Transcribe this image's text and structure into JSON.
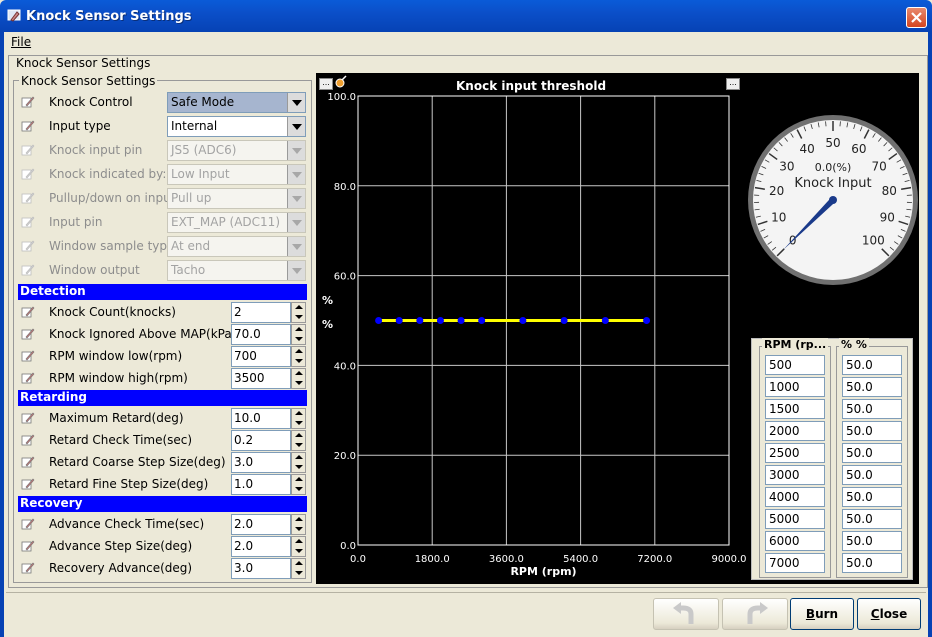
{
  "window": {
    "title": "Knock Sensor Settings"
  },
  "menu": {
    "file": "File"
  },
  "outer_group": {
    "legend": "Knock Sensor Settings"
  },
  "inner_group": {
    "legend": "Knock Sensor Settings"
  },
  "settings": [
    {
      "label": "Knock Control",
      "value": "Safe Mode",
      "type": "combo",
      "enabled": true,
      "highlight": true
    },
    {
      "label": "Input type",
      "value": "Internal",
      "type": "combo",
      "enabled": true
    },
    {
      "label": "Knock input pin",
      "value": "JS5 (ADC6)",
      "type": "combo",
      "enabled": false
    },
    {
      "label": "Knock indicated by:",
      "value": "Low Input",
      "type": "combo",
      "enabled": false
    },
    {
      "label": "Pullup/down on input",
      "value": "Pull up",
      "type": "combo",
      "enabled": false
    },
    {
      "label": "Input pin",
      "value": "EXT_MAP (ADC11)",
      "type": "combo",
      "enabled": false
    },
    {
      "label": "Window sample type",
      "value": "At end",
      "type": "combo",
      "enabled": false
    },
    {
      "label": "Window output",
      "value": "Tacho",
      "type": "combo",
      "enabled": false
    }
  ],
  "sections": {
    "detection": "Detection",
    "retarding": "Retarding",
    "recovery": "Recovery"
  },
  "detection": [
    {
      "label": "Knock Count(knocks)",
      "value": "2"
    },
    {
      "label": "Knock Ignored Above MAP(kPa)",
      "value": "70.0"
    },
    {
      "label": "RPM window low(rpm)",
      "value": "700"
    },
    {
      "label": "RPM window high(rpm)",
      "value": "3500"
    }
  ],
  "retarding": [
    {
      "label": "Maximum Retard(deg)",
      "value": "10.0"
    },
    {
      "label": "Retard Check Time(sec)",
      "value": "0.2"
    },
    {
      "label": "Retard Coarse Step Size(deg)",
      "value": "3.0"
    },
    {
      "label": "Retard Fine Step Size(deg)",
      "value": "1.0"
    }
  ],
  "recovery": [
    {
      "label": "Advance Check Time(sec)",
      "value": "2.0"
    },
    {
      "label": "Advance Step Size(deg)",
      "value": "2.0"
    },
    {
      "label": "Recovery Advance(deg)",
      "value": "3.0"
    }
  ],
  "chart_data": {
    "type": "line",
    "title": "Knock input threshold",
    "xlabel": "RPM (rpm)",
    "ylabel": "%",
    "ylabel2": "%",
    "xlim": [
      0,
      9000
    ],
    "ylim": [
      0,
      100
    ],
    "xticks": [
      "0.0",
      "1800.0",
      "3600.0",
      "5400.0",
      "7200.0",
      "9000.0"
    ],
    "yticks": [
      "0.0",
      "20.0",
      "40.0",
      "60.0",
      "80.0",
      "100.0"
    ],
    "x": [
      500,
      1000,
      1500,
      2000,
      2500,
      3000,
      4000,
      5000,
      6000,
      7000
    ],
    "series": [
      {
        "values": [
          50,
          50,
          50,
          50,
          50,
          50,
          50,
          50,
          50,
          50
        ]
      }
    ],
    "grid": true,
    "line_color": "#ffff00",
    "point_color": "#0000ff",
    "menu_button": "..."
  },
  "gauge": {
    "title": "Knock Input",
    "value_text": "0.0(%)",
    "value": 0,
    "min": 0,
    "max": 100,
    "ticks": [
      "0",
      "10",
      "20",
      "30",
      "40",
      "50",
      "60",
      "70",
      "80",
      "90",
      "100"
    ]
  },
  "table": {
    "col_rpm": "RPM (rp...",
    "col_pct": "% %",
    "rpm": [
      "500",
      "1000",
      "1500",
      "2000",
      "2500",
      "3000",
      "4000",
      "5000",
      "6000",
      "7000"
    ],
    "pct": [
      "50.0",
      "50.0",
      "50.0",
      "50.0",
      "50.0",
      "50.0",
      "50.0",
      "50.0",
      "50.0",
      "50.0"
    ]
  },
  "buttons": {
    "burn_ul": "B",
    "burn_rest": "urn",
    "close_ul": "C",
    "close_rest": "lose"
  }
}
